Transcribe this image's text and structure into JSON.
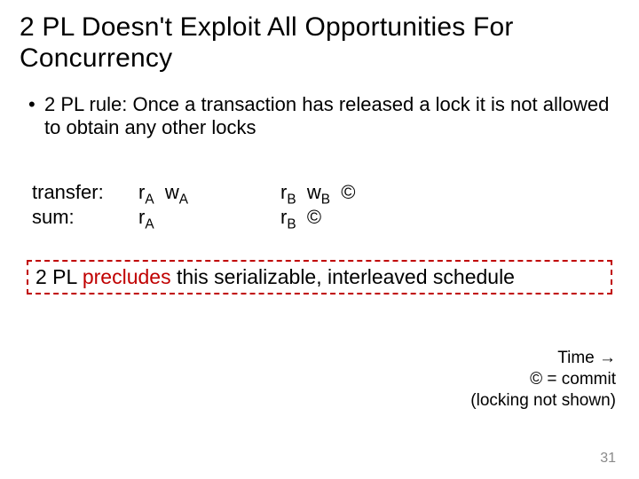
{
  "title": "2 PL Doesn't Exploit All Opportunities For Concurrency",
  "bullet1": "2 PL rule: Once a transaction has released a lock it is not allowed to obtain any other locks",
  "sched": {
    "rowLabels": [
      "transfer:",
      "sum:"
    ],
    "transfer": {
      "ra": "r",
      "raSub": "A",
      "wa": "w",
      "waSub": "A",
      "rb": "r",
      "rbSub": "B",
      "wb": "w",
      "wbSub": "B",
      "commit": "©"
    },
    "sum": {
      "ra": "r",
      "raSub": "A",
      "rb": "r",
      "rbSub": "B",
      "commit": "©"
    }
  },
  "callout": {
    "pre": "2 PL ",
    "hot": "precludes",
    "post": " this serializable, interleaved schedule"
  },
  "legend": {
    "l1a": "Time ",
    "l1b": "→",
    "l2": "© = commit",
    "l3": "(locking not shown)"
  },
  "page": "31"
}
